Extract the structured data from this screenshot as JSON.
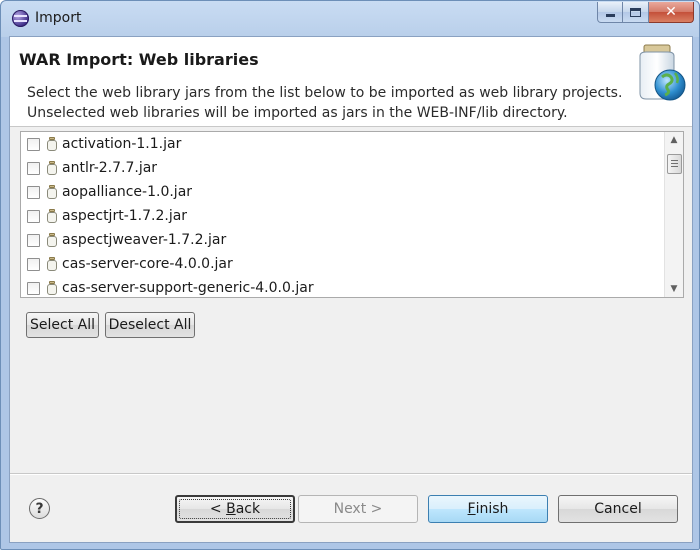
{
  "window": {
    "title": "Import"
  },
  "header": {
    "title": "WAR Import: Web libraries",
    "description_line1": "Select the web library jars from the list below to be imported as web library projects.",
    "description_line2": "Unselected web libraries will be imported as jars in the WEB-INF/lib directory."
  },
  "libraries": [
    {
      "name": "activation-1.1.jar",
      "checked": false
    },
    {
      "name": "antlr-2.7.7.jar",
      "checked": false
    },
    {
      "name": "aopalliance-1.0.jar",
      "checked": false
    },
    {
      "name": "aspectjrt-1.7.2.jar",
      "checked": false
    },
    {
      "name": "aspectjweaver-1.7.2.jar",
      "checked": false
    },
    {
      "name": "cas-server-core-4.0.0.jar",
      "checked": false
    },
    {
      "name": "cas-server-support-generic-4.0.0.jar",
      "checked": false
    }
  ],
  "selection_buttons": {
    "select_all": "Select All",
    "deselect_all": "Deselect All"
  },
  "footer": {
    "help": "?",
    "back_prefix": "< ",
    "back_mnemonic": "B",
    "back_rest": "ack",
    "next": "Next >",
    "finish_mnemonic": "F",
    "finish_rest": "inish",
    "cancel": "Cancel"
  },
  "colors": {
    "title_bar": "#b9cfea",
    "close_button": "#c4503a",
    "default_button": "#3c7fb1"
  },
  "icons": {
    "app": "eclipse-icon",
    "banner": "web-library-jar-globe-icon",
    "list_item": "jar-icon",
    "help": "help-icon"
  }
}
